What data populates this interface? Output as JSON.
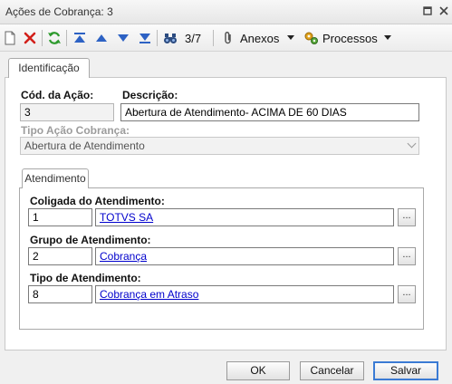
{
  "window": {
    "title": "Ações de Cobrança: 3"
  },
  "toolbar": {
    "record_counter": "3/7",
    "anexos_label": "Anexos",
    "processos_label": "Processos"
  },
  "tabs": {
    "identificacao": "Identificação"
  },
  "form": {
    "cod_label": "Cód. da Ação:",
    "cod_value": "3",
    "descricao_label": "Descrição:",
    "descricao_value": "Abertura de Atendimento- ACIMA DE 60 DIAS",
    "tipo_label": "Tipo Ação Cobrança:",
    "tipo_value": "Abertura de Atendimento"
  },
  "atendimento": {
    "tab_label": "Atendimento",
    "coligada": {
      "label": "Coligada do Atendimento:",
      "code": "1",
      "name": "TOTVS SA"
    },
    "grupo": {
      "label": "Grupo de Atendimento:",
      "code": "2",
      "name": "Cobrança"
    },
    "tipo": {
      "label": "Tipo de Atendimento:",
      "code": "8",
      "name": "Cobrança em Atraso"
    },
    "ellipsis": "..."
  },
  "buttons": {
    "ok": "OK",
    "cancelar": "Cancelar",
    "salvar": "Salvar"
  }
}
